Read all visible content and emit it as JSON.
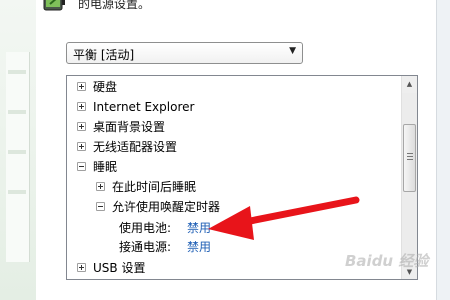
{
  "window": {
    "intro_text": "的电源设置。"
  },
  "plan_selector": {
    "selected": "平衡 [活动]"
  },
  "tree": {
    "items": [
      {
        "label": "硬盘",
        "expander": "+"
      },
      {
        "label": "Internet Explorer",
        "expander": "+"
      },
      {
        "label": "桌面背景设置",
        "expander": "+"
      },
      {
        "label": "无线适配器设置",
        "expander": "+"
      },
      {
        "label": "睡眠",
        "expander": "−"
      },
      {
        "label": "在此时间后睡眠",
        "expander": "+"
      },
      {
        "label": "允许使用唤醒定时器",
        "expander": "−"
      },
      {
        "label": "使用电池:",
        "value": "禁用"
      },
      {
        "label": "接通电源:",
        "value": "禁用"
      },
      {
        "label": "USB 设置",
        "expander": "+"
      }
    ]
  },
  "annotation": {
    "arrow_color": "#e8141a"
  },
  "watermark": {
    "text": "Baidu 经验"
  },
  "colors": {
    "link_value": "#1f5fb5",
    "panel_border": "#828790"
  },
  "icons": {
    "battery": "battery-plug-icon",
    "expander_plus": "plus-box-icon",
    "expander_minus": "minus-box-icon",
    "dropdown": "chevron-down-icon"
  }
}
